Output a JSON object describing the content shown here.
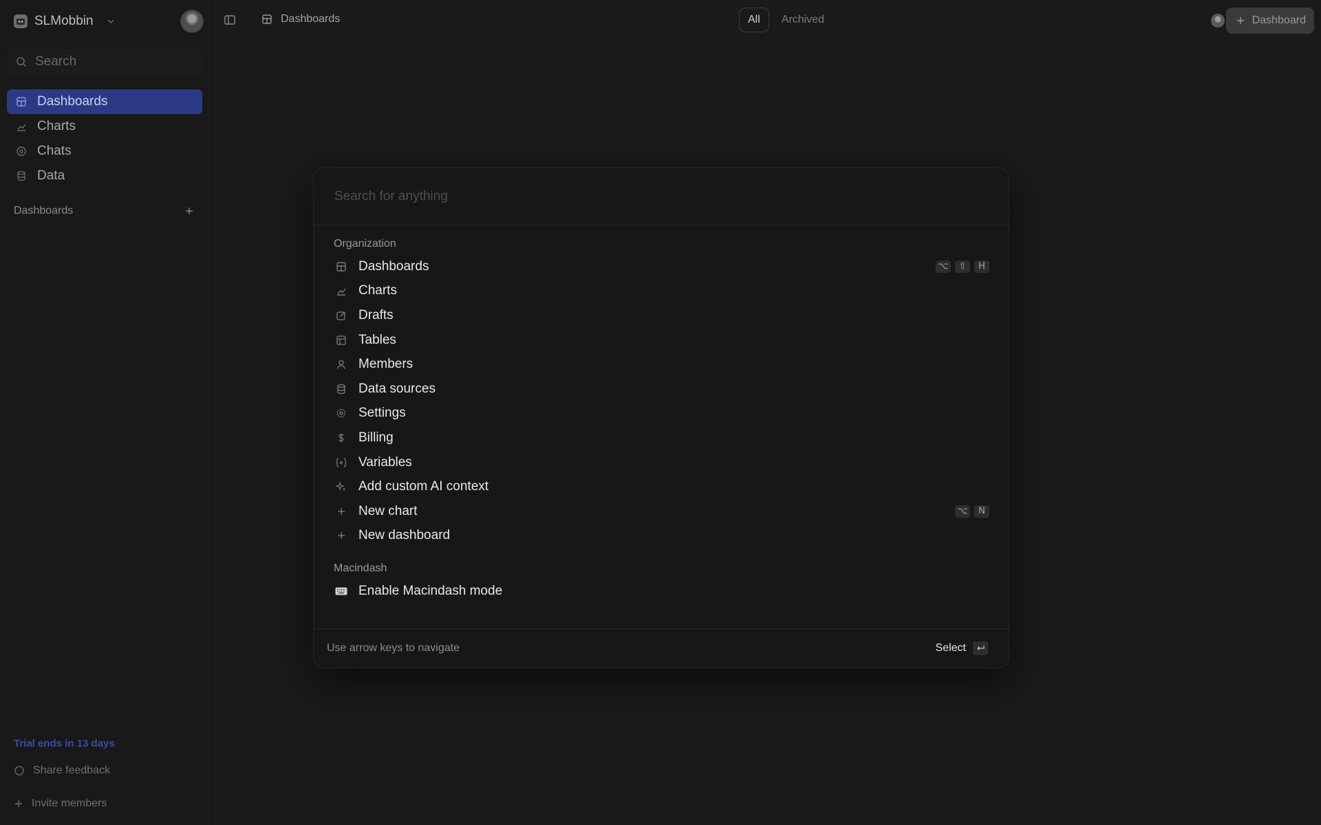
{
  "colors": {
    "background": "#1a1a1a",
    "accent": "#2c3a86",
    "trial": "#3e4aa8"
  },
  "workspace": {
    "name": "SLMobbin",
    "logo_icon": "workspace-logo-icon"
  },
  "sidebar": {
    "search_label": "Search",
    "items": [
      {
        "label": "Dashboards",
        "icon": "dashboard-icon",
        "active": true
      },
      {
        "label": "Charts",
        "icon": "chart-icon",
        "active": false
      },
      {
        "label": "Chats",
        "icon": "chat-icon",
        "active": false
      },
      {
        "label": "Data",
        "icon": "database-icon",
        "active": false
      }
    ],
    "section_label": "Dashboards",
    "trial_text": "Trial ends in 13 days",
    "share_feedback": "Share feedback",
    "invite_members": "Invite members"
  },
  "topbar": {
    "breadcrumb": "Dashboards",
    "tab_all": "All",
    "tab_archived": "Archived",
    "new_button": "Dashboard"
  },
  "palette": {
    "placeholder": "Search for anything",
    "groups": [
      {
        "label": "Organization",
        "items": [
          {
            "label": "Dashboards",
            "icon": "dashboard-icon",
            "shortcut": [
              "⌥",
              "⇧",
              "H"
            ]
          },
          {
            "label": "Charts",
            "icon": "chart-icon"
          },
          {
            "label": "Drafts",
            "icon": "edit-icon"
          },
          {
            "label": "Tables",
            "icon": "table-icon"
          },
          {
            "label": "Members",
            "icon": "user-icon"
          },
          {
            "label": "Data sources",
            "icon": "database-icon"
          },
          {
            "label": "Settings",
            "icon": "gear-icon"
          },
          {
            "label": "Billing",
            "icon": "dollar-icon"
          },
          {
            "label": "Variables",
            "icon": "variable-icon"
          },
          {
            "label": "Add custom AI context",
            "icon": "sparkle-icon"
          },
          {
            "label": "New chart",
            "icon": "plus-icon",
            "shortcut": [
              "⌥",
              "N"
            ]
          },
          {
            "label": "New dashboard",
            "icon": "plus-icon"
          }
        ]
      },
      {
        "label": "Macindash",
        "items": [
          {
            "label": "Enable Macindash mode",
            "icon": "keyboard-icon"
          }
        ]
      }
    ],
    "footer_hint": "Use arrow keys to navigate",
    "footer_select": "Select"
  }
}
